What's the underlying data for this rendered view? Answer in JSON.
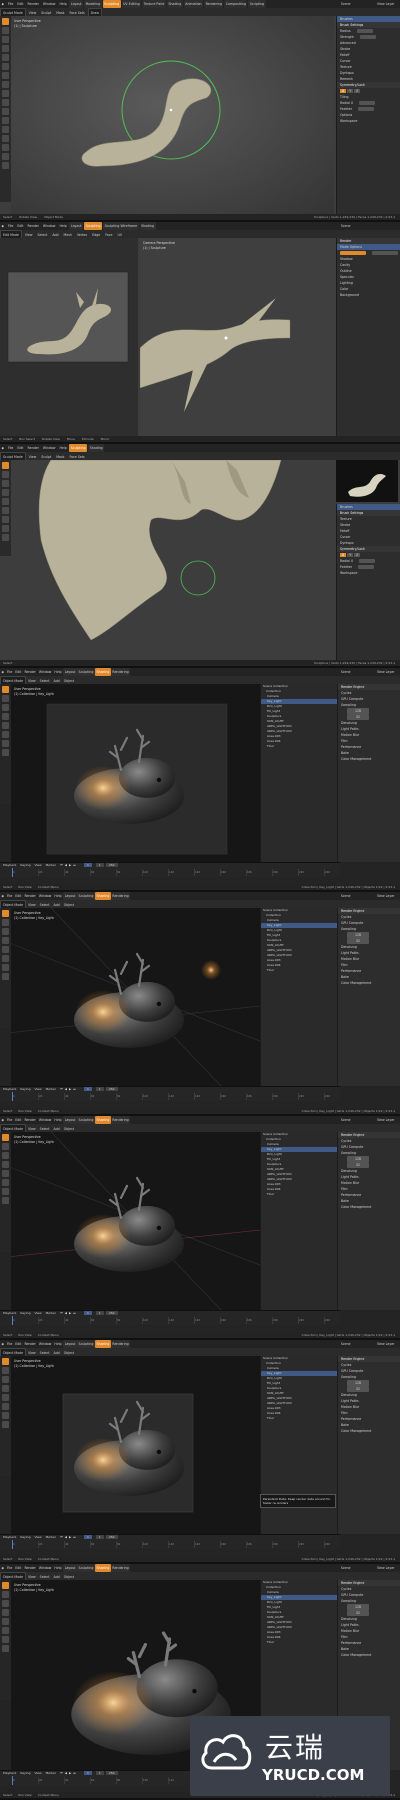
{
  "menu": [
    "File",
    "Edit",
    "Render",
    "Window",
    "Help"
  ],
  "workspace_tabs": [
    "Layout",
    "Modeling",
    "Sculpting",
    "UV Editing",
    "Texture Paint",
    "Shading",
    "Animation",
    "Rendering",
    "Compositing",
    "Scripting"
  ],
  "workspace_tabs_short": [
    "Layout",
    "Sculpting",
    "Sculpting Wireframe",
    "Shading",
    "Scene"
  ],
  "scene_label": "Scene",
  "view_layer": "View Layer",
  "sculpt": {
    "mode": "Sculpt Mode",
    "header_menus": [
      "View",
      "Sculpt",
      "Mask",
      "Face Sets"
    ],
    "brush": "Draw",
    "viewport_info": [
      "User Perspective",
      "(1) | Sculpture"
    ],
    "props_sections": [
      "Brushes",
      "Brush Settings",
      "Radius",
      "Strength",
      "Advanced",
      "Stroke",
      "Falloff",
      "Cursor",
      "Texture",
      "Dyntopo",
      "Remesh",
      "Symmetry/Lock",
      "Options",
      "Workspace"
    ],
    "sym_axes": [
      "X",
      "Y",
      "Z"
    ],
    "tiling_label": "Tiling",
    "radial_label": "Radial X",
    "feather_label": "Feather",
    "status": [
      "Select",
      "Rotate View",
      "Object Mode"
    ],
    "stats": "Sculpture | Verts 1,249,232 | Faces 1,249,232 | 2.93.1"
  },
  "edit": {
    "mode": "Edit Mode",
    "header_menus": [
      "View",
      "Select",
      "Add",
      "Mesh",
      "Vertex",
      "Edge",
      "Face",
      "UV"
    ],
    "viewport_info": [
      "Camera Perspective",
      "(1) | Sculpture"
    ],
    "props_sections": [
      "Mode Options",
      "Shadow",
      "Cavity",
      "Outline",
      "Specular",
      "Lighting",
      "Color",
      "Background"
    ],
    "render_label": "Render",
    "status_labels": [
      "Select",
      "Box Select",
      "Rotate View",
      "Move",
      "Extrude",
      "Mirror"
    ]
  },
  "shading": {
    "header_menus": [
      "Object Mode",
      "View",
      "Select",
      "Add",
      "Object"
    ],
    "viewport_info": [
      "User Perspective",
      "(1) Collection | Key_Light"
    ],
    "outliner_items": [
      "Scene Collection",
      "Collection",
      "Camera",
      "Key_Light",
      "Rim_Light",
      "Fill_Light",
      "Sculpture",
      "SUN_LIGHT",
      "AREA_LIGHT.001",
      "AREA_LIGHT.002",
      "Area.003",
      "Area.004",
      "Floor"
    ],
    "render_sections": [
      "Render Engine",
      "Sampling",
      "Denoising",
      "Light Paths",
      "Motion Blur",
      "Film",
      "Performance",
      "Bake",
      "Color Management"
    ],
    "render_engine": "Cycles",
    "device": "GPU Compute",
    "render_samples": "128",
    "viewport_samples": "32",
    "transport": [
      "Playback",
      "Keying",
      "View",
      "Marker"
    ],
    "frame_current": "1",
    "frame_start": "1",
    "frame_end": "250",
    "timeline_ticks": [
      "0",
      "20",
      "40",
      "60",
      "80",
      "100",
      "120",
      "140",
      "160",
      "180",
      "200",
      "220",
      "240"
    ],
    "tooltip": "Persistent Data: Keep render data around for faster re-renders",
    "status": [
      "Select",
      "Pan View",
      "Context Menu"
    ],
    "stats": "Collection | Key_Light | Verts 1,249,232 | Objects 1/12 | 2.93.1"
  },
  "watermark": {
    "cn": "云瑞",
    "en": "YRUCD.COM"
  },
  "colors": {
    "accent": "#e08a2c",
    "selection": "#3f5a86",
    "brush_circle": "#4fbf57",
    "clay": "#b8b29a",
    "ui_bg": "#2d2d2d",
    "viewport_bg": "#3e3e3e",
    "render_bg": "#111111"
  }
}
